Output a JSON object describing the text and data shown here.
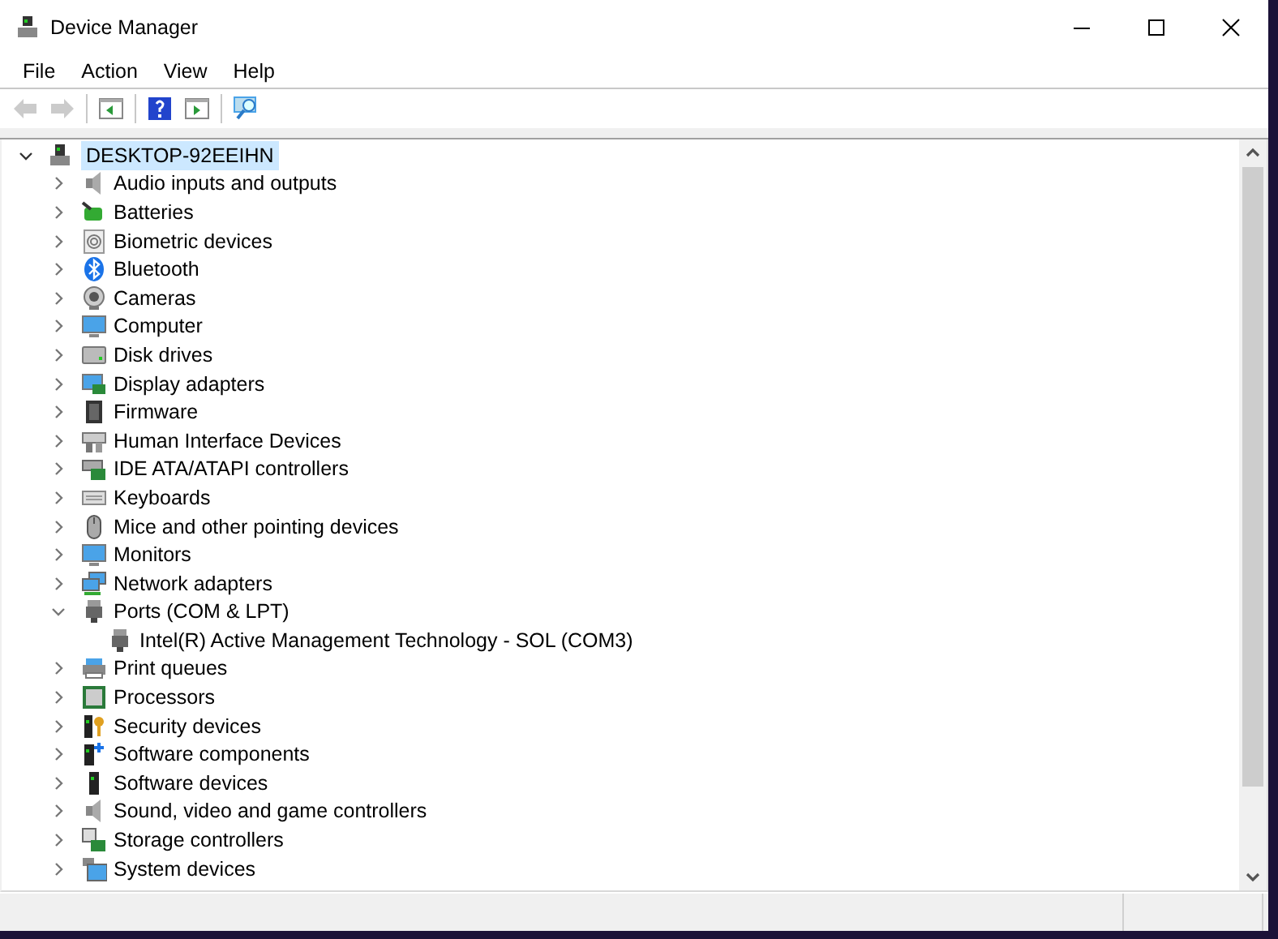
{
  "window": {
    "title": "Device Manager"
  },
  "menu": [
    "File",
    "Action",
    "View",
    "Help"
  ],
  "toolbar": [
    {
      "kind": "back",
      "disabled": true
    },
    {
      "kind": "forward",
      "disabled": true
    },
    {
      "kind": "properties",
      "disabled": false
    },
    {
      "kind": "help",
      "disabled": false
    },
    {
      "kind": "update",
      "disabled": false
    },
    {
      "kind": "scan",
      "disabled": false
    }
  ],
  "tree": {
    "label": "DESKTOP-92EEIHN",
    "expanded": true,
    "selected": true,
    "children": [
      {
        "label": "Audio inputs and outputs",
        "expanded": false
      },
      {
        "label": "Batteries",
        "expanded": false
      },
      {
        "label": "Biometric devices",
        "expanded": false
      },
      {
        "label": "Bluetooth",
        "expanded": false
      },
      {
        "label": "Cameras",
        "expanded": false
      },
      {
        "label": "Computer",
        "expanded": false
      },
      {
        "label": "Disk drives",
        "expanded": false
      },
      {
        "label": "Display adapters",
        "expanded": false
      },
      {
        "label": "Firmware",
        "expanded": false
      },
      {
        "label": "Human Interface Devices",
        "expanded": false
      },
      {
        "label": "IDE ATA/ATAPI controllers",
        "expanded": false
      },
      {
        "label": "Keyboards",
        "expanded": false
      },
      {
        "label": "Mice and other pointing devices",
        "expanded": false
      },
      {
        "label": "Monitors",
        "expanded": false
      },
      {
        "label": "Network adapters",
        "expanded": false
      },
      {
        "label": "Ports (COM & LPT)",
        "expanded": true,
        "children": [
          {
            "label": "Intel(R) Active Management Technology - SOL (COM3)"
          }
        ]
      },
      {
        "label": "Print queues",
        "expanded": false
      },
      {
        "label": "Processors",
        "expanded": false
      },
      {
        "label": "Security devices",
        "expanded": false
      },
      {
        "label": "Software components",
        "expanded": false
      },
      {
        "label": "Software devices",
        "expanded": false
      },
      {
        "label": "Sound, video and game controllers",
        "expanded": false
      },
      {
        "label": "Storage controllers",
        "expanded": false
      },
      {
        "label": "System devices",
        "expanded": false
      }
    ]
  }
}
